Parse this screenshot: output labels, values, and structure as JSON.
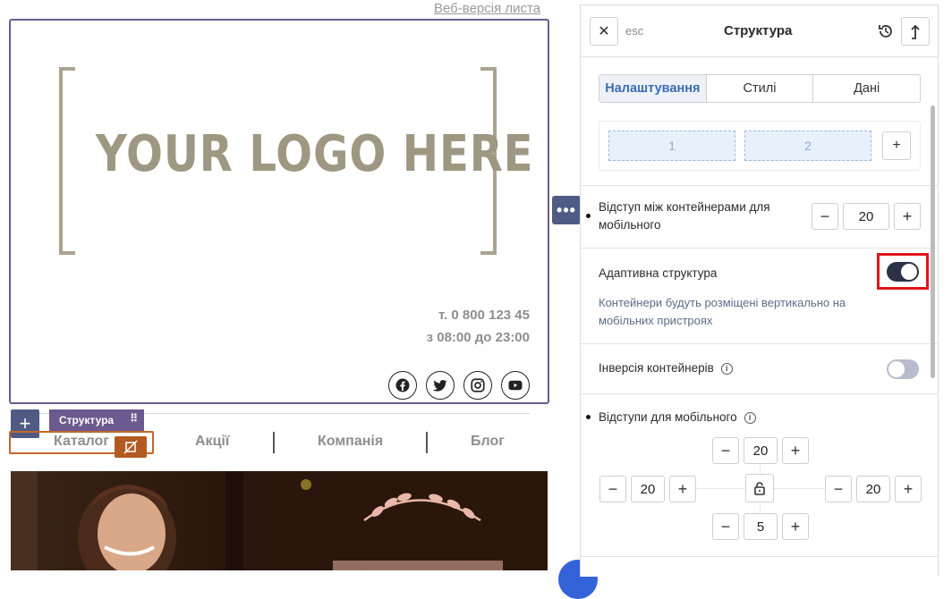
{
  "canvas": {
    "web_version_link": "Веб-версія листа",
    "logo_text": "YOUR LOGO HERE",
    "phone": "т. 0 800 123 45",
    "hours": "з 08:00 до 23:00",
    "social_icons": [
      "facebook-icon",
      "twitter-icon",
      "instagram-icon",
      "youtube-icon"
    ],
    "structure_tag": "Структура",
    "menu": [
      "Каталог",
      "Акції",
      "Компанія",
      "Блог"
    ],
    "add_label": "+",
    "more_label": "•••"
  },
  "panel": {
    "close_label": "✕",
    "esc_label": "esc",
    "title": "Структура",
    "tabs": [
      "Налаштування",
      "Стилі",
      "Дані"
    ],
    "active_tab": 0,
    "columns": [
      "1",
      "2"
    ],
    "add_column": "+",
    "mobile_gap": {
      "label": "Відступ між контейнерами для мобільного",
      "value": "20"
    },
    "adaptive": {
      "label": "Адаптивна структура",
      "enabled": true,
      "description": "Контейнери будуть розміщені вертикально на мобільних пристроях"
    },
    "inversion": {
      "label": "Інверсія контейнерів",
      "enabled": false
    },
    "mobile_padding": {
      "label": "Відступи для мобільного",
      "top": "20",
      "left": "20",
      "right": "20",
      "bottom": "5"
    },
    "minus": "−",
    "plus": "+"
  },
  "colors": {
    "accent_purple": "#6a5a8e",
    "accent_blue": "#3c6cb7",
    "toggle_on": "#2b3247",
    "toggle_off": "#b8bccc",
    "highlight_red": "#e0141b",
    "selection_orange": "#c2662c"
  }
}
